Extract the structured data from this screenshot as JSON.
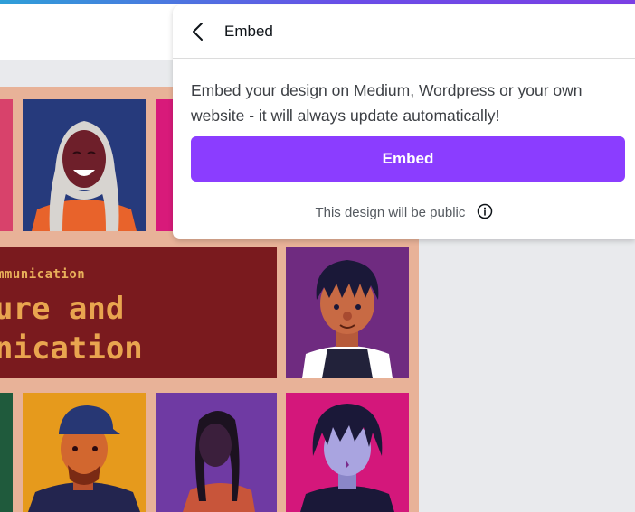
{
  "colors": {
    "accent": "#8b3dff",
    "top_gradient": [
      "#2e9fd8",
      "#7b3fe4"
    ],
    "design_background": "#e8b298",
    "title_panel": "#7a1a1e",
    "title_text": "#e9a54f"
  },
  "design": {
    "subtitle": "mmunication",
    "title_line1": "ure and",
    "title_line2": "nication"
  },
  "embed_panel": {
    "back_icon": "chevron-left-icon",
    "title": "Embed",
    "description": "Embed your design on Medium, Wordpress or your own website - it will always update automatically!",
    "button_label": "Embed",
    "public_note": "This design will be public",
    "info_icon": "info-circle-icon"
  }
}
